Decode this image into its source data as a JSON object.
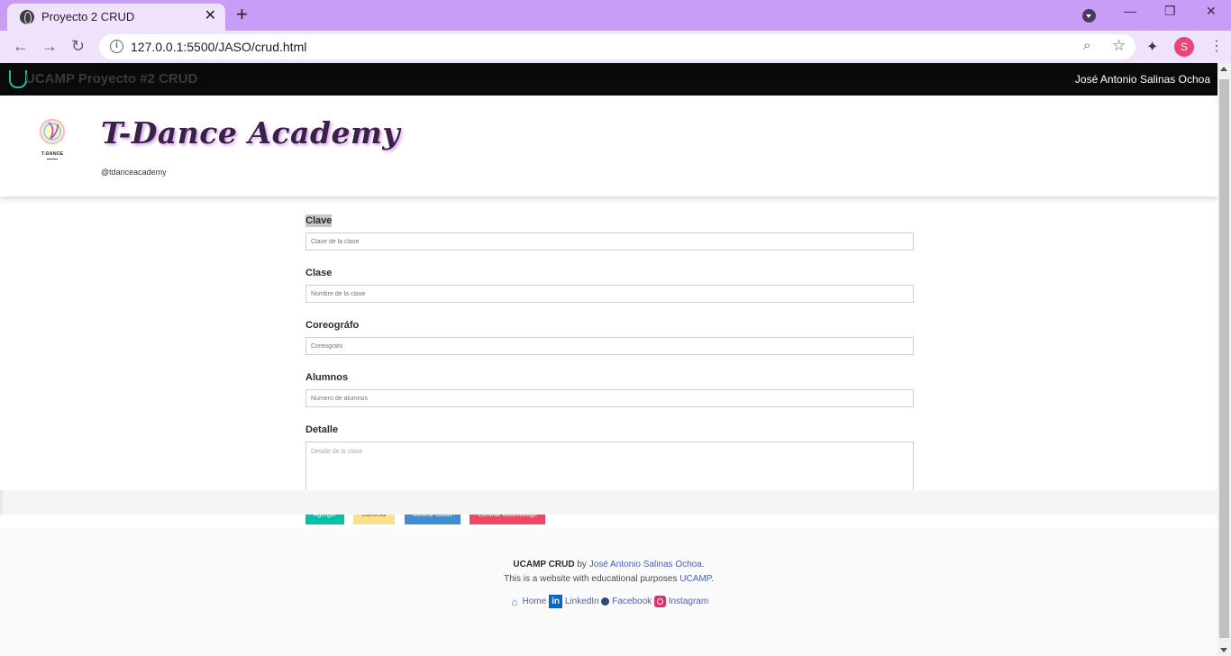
{
  "browser": {
    "tab_title": "Proyecto 2 CRUD",
    "tab_close": "✕",
    "new_tab": "+",
    "url": "127.0.0.1:5500/JASO/crud.html",
    "profile_initial": "S",
    "window_minimize": "—",
    "window_restore": "❐",
    "window_close": "✕"
  },
  "topnav": {
    "brand": "UCAMP Proyecto #2 CRUD",
    "author": "José Antonio Salinas Ochoa"
  },
  "hero": {
    "logo_caption": "T-DANCE",
    "title": "T-Dance Academy",
    "handle": "@tdanceacademy"
  },
  "form": {
    "fields": [
      {
        "label": "Clave",
        "placeholder": "Clave de la clase"
      },
      {
        "label": "Clase",
        "placeholder": "Nombre de la clase"
      },
      {
        "label": "Coreográfo",
        "placeholder": "Coreografo"
      },
      {
        "label": "Alumnos",
        "placeholder": "Numero de alumnos"
      },
      {
        "label": "Detalle",
        "placeholder": "Detalle de la clase"
      }
    ],
    "buttons": {
      "add": "Agregar",
      "cancel": "Cancelar",
      "show": "Mostrar Datos",
      "delete": "Eliminar localStorage"
    }
  },
  "footer": {
    "brand": "UCAMP CRUD",
    "by": "by",
    "author_link": "José Antonio Salinas Ochoa",
    "purpose_text": "This is a website with educational purposes",
    "ucamp_link": "UCAMP",
    "links": {
      "home": "Home",
      "linkedin": "LinkedIn",
      "facebook": "Facebook",
      "instagram": "Instagram"
    }
  },
  "colors": {
    "tab_strip": "#c79df5",
    "toolbar": "#efe3fc",
    "navbar": "#0a0a0a",
    "add_button": "#00c4a7",
    "cancel_button": "#ffe08a",
    "show_button": "#3e8ed0",
    "delete_button": "#f14668",
    "link": "#485fc7"
  }
}
